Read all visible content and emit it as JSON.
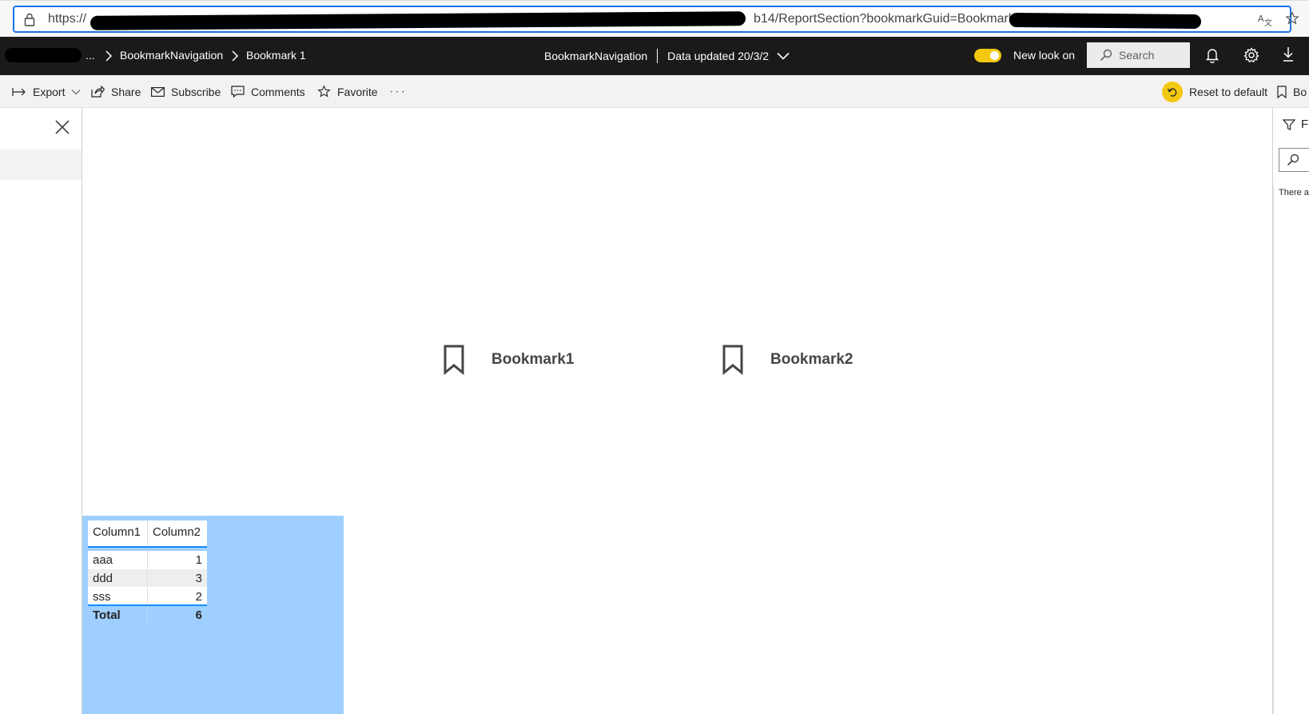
{
  "browser": {
    "url_prefix": "https://",
    "url_visible_middle": "b14/ReportSection?bookmarkGuid=Bookmarke"
  },
  "header": {
    "breadcrumb_ellipsis": "...",
    "breadcrumb_report": "BookmarkNavigation",
    "breadcrumb_page": "Bookmark 1",
    "center_report_name": "BookmarkNavigation",
    "center_data_updated": "Data updated 20/3/2",
    "new_look_label": "New look on",
    "search_placeholder": "Search"
  },
  "action_bar": {
    "export": "Export",
    "share": "Share",
    "subscribe": "Subscribe",
    "comments": "Comments",
    "favorite": "Favorite",
    "more": "···",
    "reset": "Reset to default",
    "bookmarks": "Bo"
  },
  "canvas": {
    "bookmark_buttons": [
      {
        "label": "Bookmark1",
        "icon": "bookmark-icon"
      },
      {
        "label": "Bookmark2",
        "icon": "bookmark-icon"
      }
    ],
    "table": {
      "columns": [
        "Column1",
        "Column2"
      ],
      "rows": [
        [
          "aaa",
          "1"
        ],
        [
          "ddd",
          "3"
        ],
        [
          "sss",
          "2"
        ]
      ],
      "total_label": "Total",
      "total_value": "6"
    }
  },
  "filters_pane": {
    "title": "F",
    "empty_text": "There a"
  },
  "colors": {
    "header_bg": "#1b1a19",
    "accent_yellow": "#f2c811",
    "table_visual_bg": "#9fcfff",
    "table_accent": "#118dff"
  }
}
